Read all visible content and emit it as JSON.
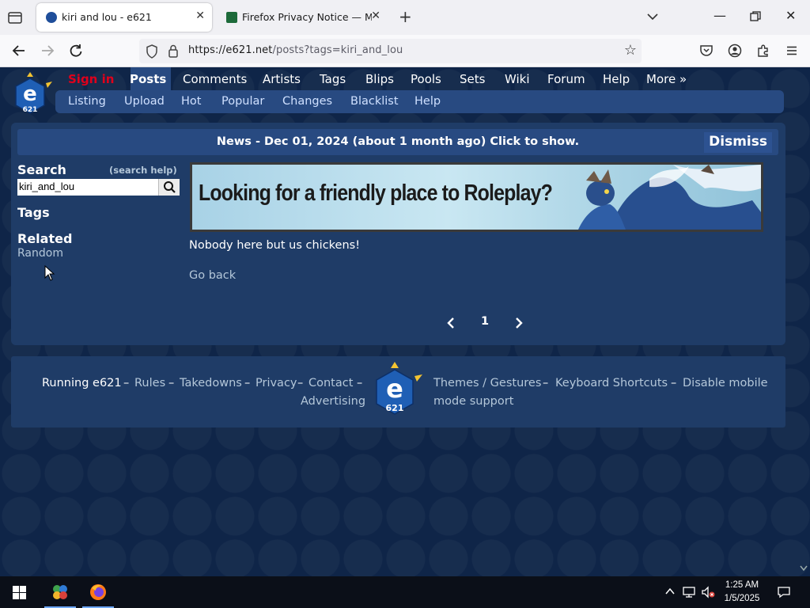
{
  "browser": {
    "tabs": [
      {
        "title": "kiri and lou - e621",
        "active": true
      },
      {
        "title": "Firefox Privacy Notice — Mozill",
        "active": false
      }
    ],
    "url_host": "https://e621.net",
    "url_path": "/posts?tags=kiri_and_lou"
  },
  "site": {
    "main_menu": [
      "Sign in",
      "Posts",
      "Comments",
      "Artists",
      "Tags",
      "Blips",
      "Pools",
      "Sets",
      "Wiki",
      "Forum",
      "Help",
      "More »"
    ],
    "sub_menu": [
      "Listing",
      "Upload",
      "Hot",
      "Popular",
      "Changes",
      "Blacklist",
      "Help"
    ],
    "news": "News - Dec 01, 2024 (about 1 month ago) Click to show.",
    "dismiss": "Dismiss",
    "sidebar": {
      "search_label": "Search",
      "search_help": "(search help)",
      "search_value": "kiri_and_lou",
      "tags_label": "Tags",
      "related_label": "Related",
      "random": "Random"
    },
    "banner_text": "Looking for a friendly place to Roleplay?",
    "no_posts": "Nobody here but us chickens!",
    "go_back": "Go back",
    "pager_current": "1",
    "footer": {
      "running": "Running e621",
      "rules": "Rules",
      "takedowns": "Takedowns",
      "privacy": "Privacy",
      "contact": "Contact",
      "advertising": "Advertising",
      "themes": "Themes / Gestures",
      "shortcuts": "Keyboard Shortcuts",
      "disable_mobile_1": "Disable mobile",
      "disable_mobile_2": "mode support"
    }
  },
  "taskbar": {
    "time": "1:25 AM",
    "date": "1/5/2025"
  },
  "colors": {
    "accent_red": "#e0001b",
    "link": "#b4c7d9",
    "section": "#1f3c67",
    "nav": "#284a81"
  }
}
